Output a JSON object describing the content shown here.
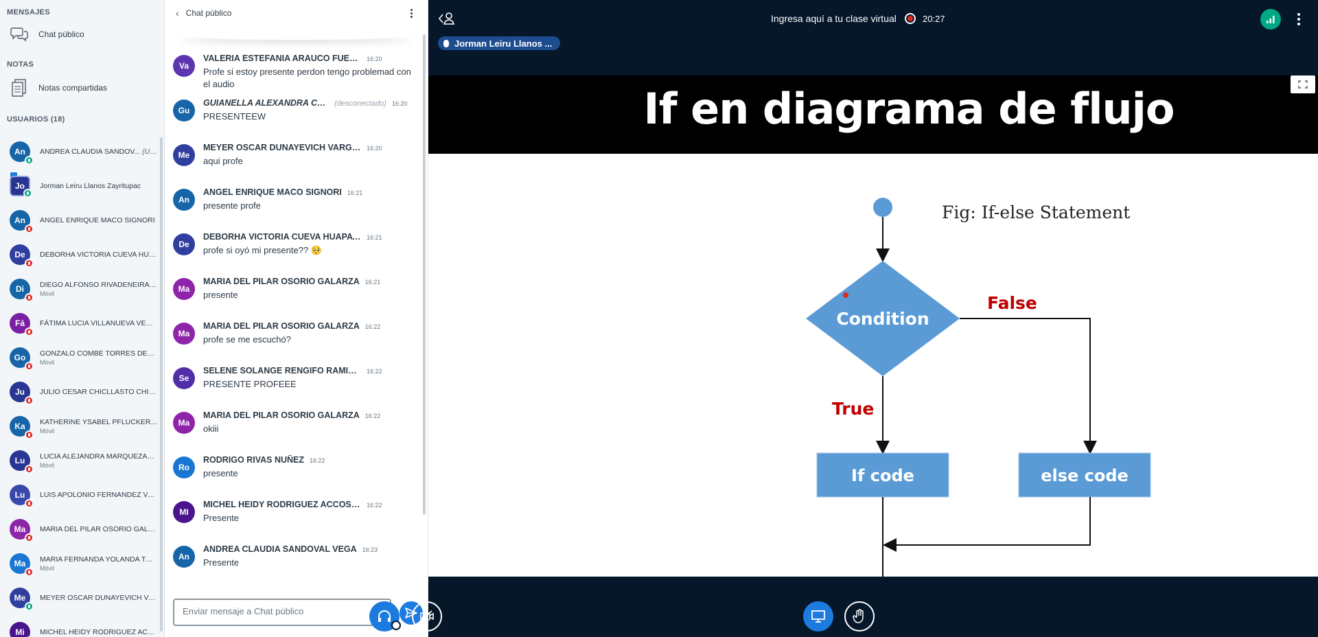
{
  "sidebar": {
    "messages_title": "MENSAJES",
    "public_chat_label": "Chat público",
    "notes_title": "NOTAS",
    "shared_notes_label": "Notas compartidas",
    "users_title": "USUARIOS (18)",
    "users": [
      {
        "initials": "An",
        "name": "ANDREA CLAUDIA SANDOV...",
        "you": "(Usted)",
        "sub": "",
        "color": "#1565a8",
        "mic": "on"
      },
      {
        "initials": "Jo",
        "name": "Jorman Leiru Llanos Zayritupac",
        "you": "",
        "sub": "",
        "color": "#283593",
        "mic": "on"
      },
      {
        "initials": "An",
        "name": "ANGEL ENRIQUE MACO SIGNORI",
        "you": "",
        "sub": "",
        "color": "#1565a8",
        "mic": "muted"
      },
      {
        "initials": "De",
        "name": "DEBORHA VICTORIA CUEVA HUAPA...",
        "you": "",
        "sub": "",
        "color": "#303f9f",
        "mic": "muted"
      },
      {
        "initials": "Di",
        "name": "DIEGO ALFONSO RIVADENEIRA TU...",
        "you": "",
        "sub": "Móvil",
        "color": "#1565a8",
        "mic": "muted"
      },
      {
        "initials": "Fá",
        "name": "FÁTIMA LUCIA VILLANUEVA VENEG...",
        "you": "",
        "sub": "",
        "color": "#7b1fa2",
        "mic": "muted"
      },
      {
        "initials": "Go",
        "name": "GONZALO COMBE TORRES DELLA ...",
        "you": "",
        "sub": "Móvil",
        "color": "#1565a8",
        "mic": "muted"
      },
      {
        "initials": "Ju",
        "name": "JULIO CESAR CHICLLASTO CHIPANA",
        "you": "",
        "sub": "",
        "color": "#283593",
        "mic": "muted"
      },
      {
        "initials": "Ka",
        "name": "KATHERINE YSABEL PFLUCKER GU...",
        "you": "",
        "sub": "Móvil",
        "color": "#1565a8",
        "mic": "muted"
      },
      {
        "initials": "Lu",
        "name": "LUCIA ALEJANDRA MARQUEZADO ...",
        "you": "",
        "sub": "Móvil",
        "color": "#283593",
        "mic": "muted"
      },
      {
        "initials": "Lu",
        "name": "LUIS APOLONIO FERNANDEZ VARG...",
        "you": "",
        "sub": "",
        "color": "#3949ab",
        "mic": "muted"
      },
      {
        "initials": "Ma",
        "name": "MARIA DEL PILAR OSORIO GALARZA",
        "you": "",
        "sub": "",
        "color": "#8e24aa",
        "mic": "muted"
      },
      {
        "initials": "Ma",
        "name": "MARIA FERNANDA YOLANDA TOVA...",
        "you": "",
        "sub": "Móvil",
        "color": "#1976d2",
        "mic": "muted"
      },
      {
        "initials": "Me",
        "name": "MEYER OSCAR DUNAYEVICH VARGAS",
        "you": "",
        "sub": "",
        "color": "#303f9f",
        "mic": "on"
      },
      {
        "initials": "Mi",
        "name": "MICHEL HEIDY RODRIGUEZ ACCOS...",
        "you": "",
        "sub": "",
        "color": "#4a148c",
        "mic": "muted"
      }
    ]
  },
  "chat": {
    "title": "Chat público",
    "input_placeholder": "Enviar mensaje a Chat público",
    "messages": [
      {
        "initials": "Va",
        "name": "VALERIA ESTEFANIA ARAUCO FUENTES",
        "time": "16:20",
        "text": "Profe si estoy presente perdon tengo problemad con el audio",
        "color": "#5e35b1",
        "offline": ""
      },
      {
        "initials": "Gu",
        "name": "GUIANELLA ALEXANDRA CRUC...",
        "time": "16:20",
        "text": "PRESENTEEW",
        "color": "#1565a8",
        "offline": "(desconectado)"
      },
      {
        "initials": "Me",
        "name": "MEYER OSCAR DUNAYEVICH VARGAS",
        "time": "16:20",
        "text": "aqui profe",
        "color": "#303f9f",
        "offline": ""
      },
      {
        "initials": "An",
        "name": "ANGEL ENRIQUE MACO SIGNORI",
        "time": "16:21",
        "text": "presente profe",
        "color": "#1565a8",
        "offline": ""
      },
      {
        "initials": "De",
        "name": "DEBORHA VICTORIA CUEVA HUAPAYA",
        "time": "16:21",
        "text": "profe si oyó mi presente?? 🥺",
        "color": "#303f9f",
        "offline": ""
      },
      {
        "initials": "Ma",
        "name": "MARIA DEL PILAR OSORIO GALARZA",
        "time": "16:21",
        "text": "presente",
        "color": "#8e24aa",
        "offline": ""
      },
      {
        "initials": "Ma",
        "name": "MARIA DEL PILAR OSORIO GALARZA",
        "time": "16:22",
        "text": "profe se me escuchó?",
        "color": "#8e24aa",
        "offline": ""
      },
      {
        "initials": "Se",
        "name": "SELENE SOLANGE RENGIFO RAMIREZ",
        "time": "16:22",
        "text": "PRESENTE PROFEEE",
        "color": "#512da8",
        "offline": ""
      },
      {
        "initials": "Ma",
        "name": "MARIA DEL PILAR OSORIO GALARZA",
        "time": "16:22",
        "text": "okiii",
        "color": "#8e24aa",
        "offline": ""
      },
      {
        "initials": "Ro",
        "name": "RODRIGO RIVAS NUÑEZ",
        "time": "16:22",
        "text": "presente",
        "color": "#1976d2",
        "offline": ""
      },
      {
        "initials": "MI",
        "name": "MICHEL HEIDY RODRIGUEZ ACCOSTUPA",
        "time": "16:22",
        "text": "Presente",
        "color": "#4a148c",
        "offline": ""
      },
      {
        "initials": "An",
        "name": "ANDREA CLAUDIA SANDOVAL VEGA",
        "time": "16:23",
        "text": "Presente",
        "color": "#1565a8",
        "offline": ""
      }
    ]
  },
  "main": {
    "meeting_title": "Ingresa aquí a tu clase virtual",
    "recording_time": "20:27",
    "talker": "Jorman Leiru Llanos ...",
    "slide": {
      "title": "If en diagrama de flujo",
      "caption": "Fig: If-else Statement",
      "condition": "Condition",
      "false_label": "False",
      "true_label": "True",
      "if_code": "If code",
      "else_code": "else code"
    }
  },
  "colors": {
    "accent": "#1d7be0",
    "background": "#06172a",
    "muted": "#df2721",
    "active": "#00a884",
    "diagram_blue": "#5b9bd5",
    "diagram_red": "#c00000"
  }
}
